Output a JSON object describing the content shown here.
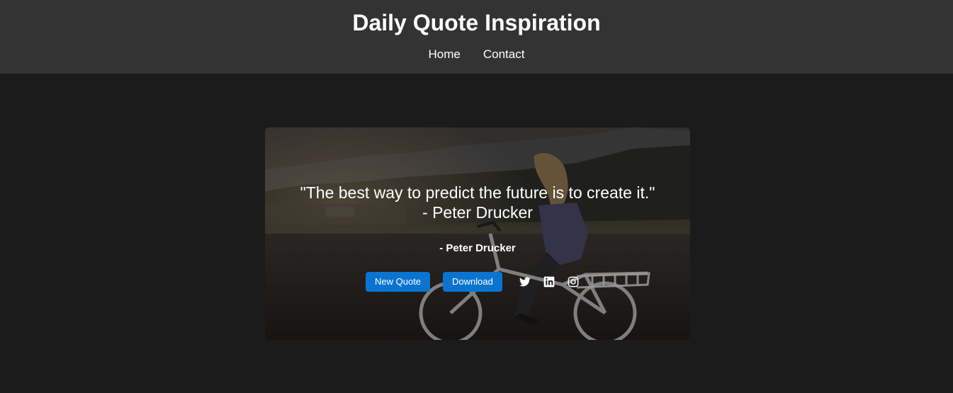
{
  "header": {
    "title": "Daily Quote Inspiration",
    "nav": [
      {
        "label": "Home"
      },
      {
        "label": "Contact"
      }
    ]
  },
  "quote": {
    "text_line1": "\"The best way to predict the future is to create it.\"",
    "text_line2": "- Peter Drucker",
    "author": "- Peter Drucker"
  },
  "actions": {
    "new_quote_label": "New Quote",
    "download_label": "Download"
  },
  "social": [
    {
      "icon": "twitter-icon"
    },
    {
      "icon": "linkedin-icon"
    },
    {
      "icon": "instagram-icon"
    }
  ],
  "colors": {
    "page_background": "#1b1b1b",
    "header_background": "#333333",
    "button": "#0a74cf",
    "text": "#ffffff"
  }
}
